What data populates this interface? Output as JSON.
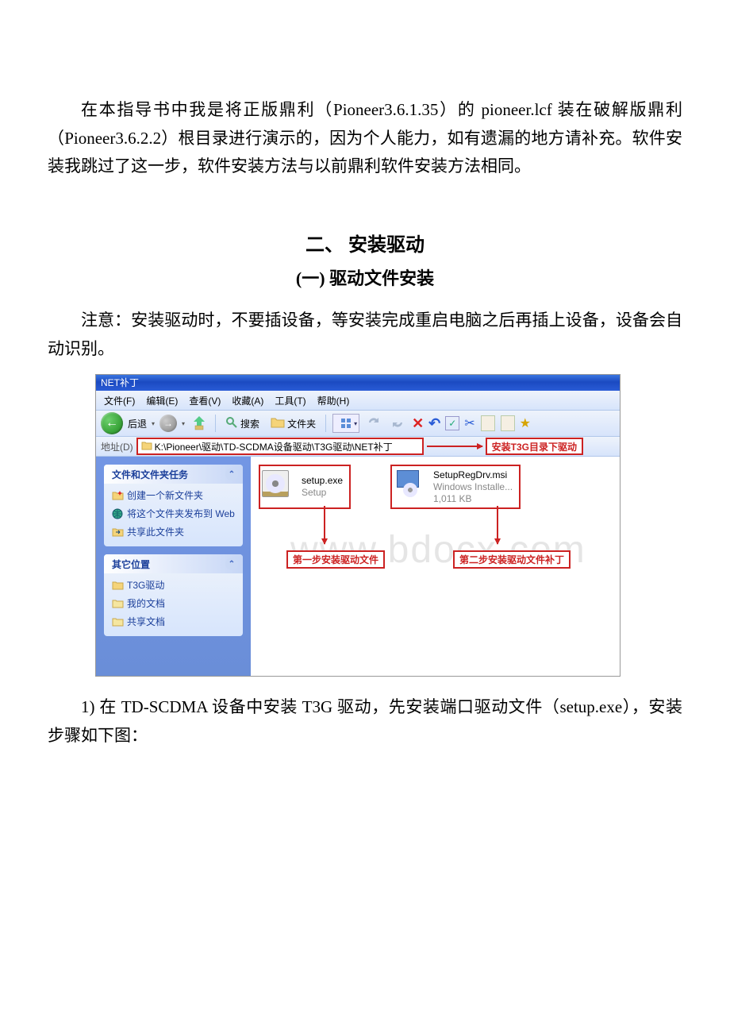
{
  "intro": "在本指导书中我是将正版鼎利（Pioneer3.6.1.35）的 pioneer.lcf 装在破解版鼎利（Pioneer3.6.2.2）根目录进行演示的，因为个人能力，如有遗漏的地方请补充。软件安装我跳过了这一步，软件安装方法与以前鼎利软件安装方法相同。",
  "heading_section": "二、 安装驱动",
  "heading_sub": "(一) 驱动文件安装",
  "note_para": "注意：安装驱动时，不要插设备，等安装完成重启电脑之后再插上设备，设备会自动识别。",
  "after_para": "1) 在 TD-SCDMA 设备中安装 T3G 驱动，先安装端口驱动文件（setup.exe），安装步骤如下图：",
  "explorer": {
    "titlebar": "NET补丁",
    "menu": {
      "file": "文件(F)",
      "edit": "编辑(E)",
      "view": "查看(V)",
      "fav": "收藏(A)",
      "tools": "工具(T)",
      "help": "帮助(H)"
    },
    "toolbar": {
      "back": "后退",
      "search": "搜索",
      "folders": "文件夹"
    },
    "address_label": "地址(D)",
    "address_path": "K:\\Pioneer\\驱动\\TD-SCDMA设备驱动\\T3G驱动\\NET补丁",
    "install_label": "安装T3G目录下驱动",
    "side": {
      "tasks_title": "文件和文件夹任务",
      "task_new": "创建一个新文件夹",
      "task_publish": "将这个文件夹发布到 Web",
      "task_share": "共享此文件夹",
      "other_title": "其它位置",
      "loc_t3g": "T3G驱动",
      "loc_mydocs": "我的文档",
      "loc_shared": "共享文档"
    },
    "files": {
      "setup_name": "setup.exe",
      "setup_type": "Setup",
      "msi_name": "SetupRegDrv.msi",
      "msi_type": "Windows Installe...",
      "msi_size": "1,011 KB"
    },
    "step1": "第一步安装驱动文件",
    "step2": "第二步安装驱动文件补丁"
  },
  "watermark": "www.bdocx.com"
}
